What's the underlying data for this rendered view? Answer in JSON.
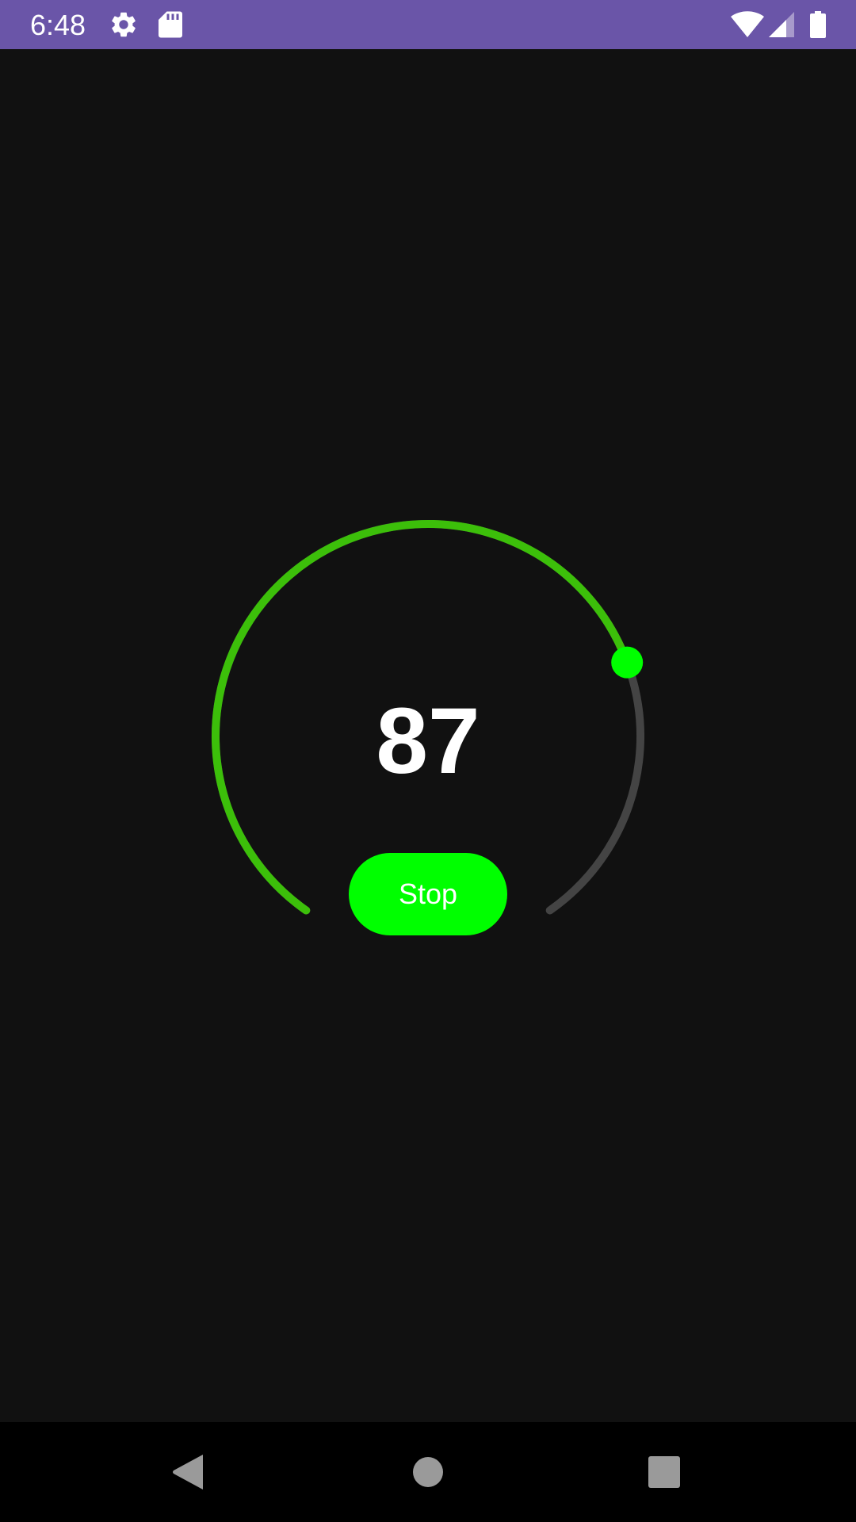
{
  "status_bar": {
    "time": "6:48",
    "background_color": "#6a55a8",
    "icons": [
      "settings-icon",
      "sd-card-icon",
      "wifi-icon",
      "cellular-signal-icon",
      "battery-icon"
    ]
  },
  "gauge": {
    "value": "87",
    "progress_fraction": 0.74,
    "progress_color": "#3cbf0a",
    "track_color": "#444444",
    "thumb_color": "#00ff00"
  },
  "stop_button": {
    "label": "Stop",
    "background_color": "#00ff00"
  },
  "nav_bar": {
    "buttons": [
      "back-icon",
      "home-icon",
      "recents-icon"
    ]
  }
}
